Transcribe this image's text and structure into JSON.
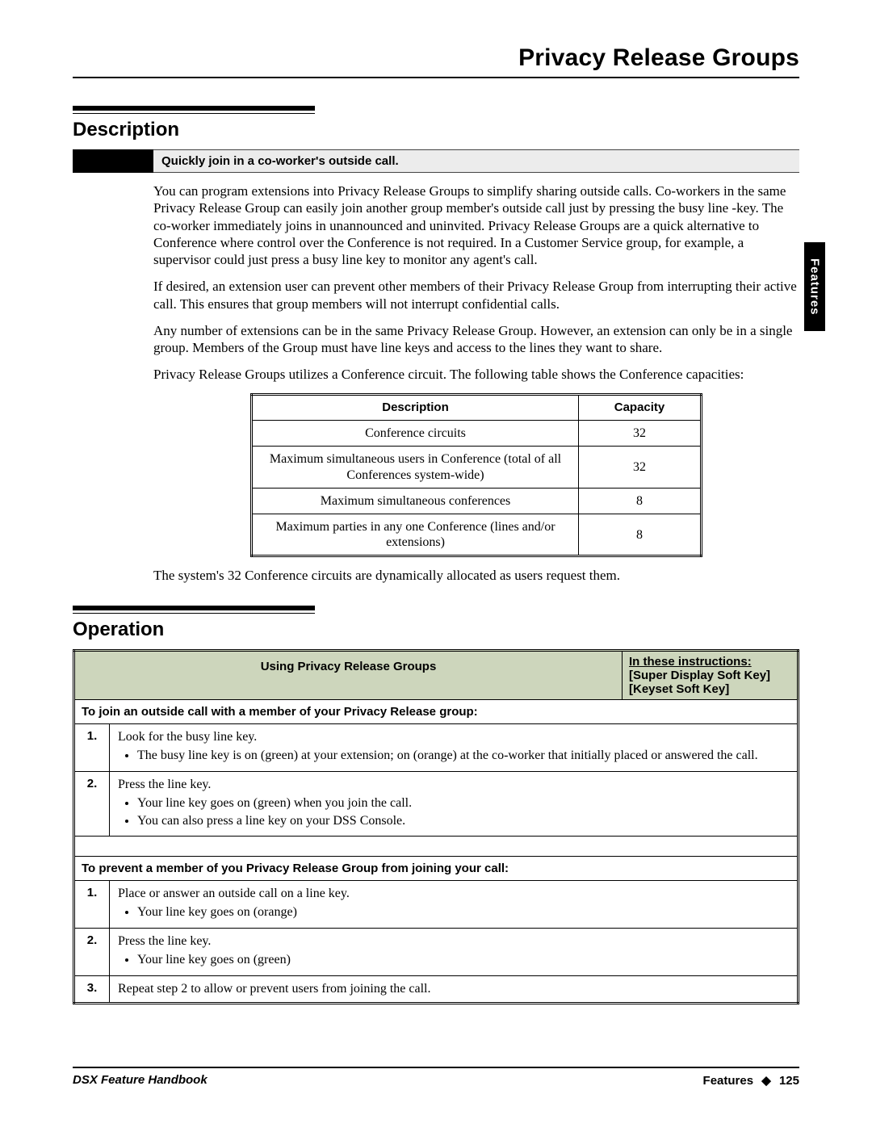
{
  "pageTitle": "Privacy Release Groups",
  "sideTab": "Features",
  "sections": {
    "description": {
      "heading": "Description",
      "callout": "Quickly join in a co-worker's outside call.",
      "p1": "You can program extensions into Privacy Release Groups to simplify sharing outside calls. Co-workers in the same Privacy Release Group can easily join another group member's outside call just by pressing the busy line -key. The co-worker immediately joins in unannounced and uninvited. Privacy Release Groups are a quick alternative to Conference where control over the Conference is not required. In a Customer Service group, for example, a supervisor could just press a busy line key to monitor any agent's call.",
      "p2": "If desired, an extension user can prevent other members of their Privacy Release Group from interrupting their active call. This ensures that group members will not interrupt confidential calls.",
      "p3": "Any number of extensions can be in the same Privacy Release Group. However, an extension can only be in a single group. Members of the Group must have line keys and access to the lines they want to share.",
      "p4": "Privacy Release Groups utilizes a Conference circuit. The following table shows the Conference capacities:",
      "capTable": {
        "headers": {
          "desc": "Description",
          "cap": "Capacity"
        },
        "rows": [
          {
            "desc": "Conference circuits",
            "cap": "32"
          },
          {
            "desc": "Maximum simultaneous users in Conference (total of all Conferences system-wide)",
            "cap": "32"
          },
          {
            "desc": "Maximum simultaneous conferences",
            "cap": "8"
          },
          {
            "desc": "Maximum parties in any one Conference (lines and/or extensions)",
            "cap": "8"
          }
        ]
      },
      "p5": "The system's 32 Conference circuits are dynamically allocated as users request them."
    },
    "operation": {
      "heading": "Operation",
      "tableTitle": "Using Privacy Release Groups",
      "legend": {
        "l1": "In these instructions:",
        "l2": "[Super Display Soft Key]",
        "l3": "[Keyset Soft Key]"
      },
      "sub1": "To join an outside call with a member of your Privacy Release group:",
      "steps1": [
        {
          "num": "1.",
          "text": "Look for the busy line key.",
          "bullets": [
            "The busy line key is on (green) at your extension; on (orange) at the co-worker that initially placed or answered the call."
          ]
        },
        {
          "num": "2.",
          "text": "Press the line key.",
          "bullets": [
            "Your line key goes on (green) when you join the call.",
            "You can also press a line key on your DSS Console."
          ]
        }
      ],
      "sub2": "To prevent a member of you Privacy Release Group from joining your call:",
      "steps2": [
        {
          "num": "1.",
          "text": "Place or answer an outside call on a line key.",
          "bullets": [
            "Your line key goes on (orange)"
          ]
        },
        {
          "num": "2.",
          "text": "Press the line key.",
          "bullets": [
            "Your line key goes on (green)"
          ]
        },
        {
          "num": "3.",
          "text": "Repeat step 2 to allow or prevent users from joining the call.",
          "bullets": []
        }
      ]
    }
  },
  "footer": {
    "left": "DSX Feature Handbook",
    "rightLabel": "Features",
    "diamond": "◆",
    "pageNum": "125"
  }
}
